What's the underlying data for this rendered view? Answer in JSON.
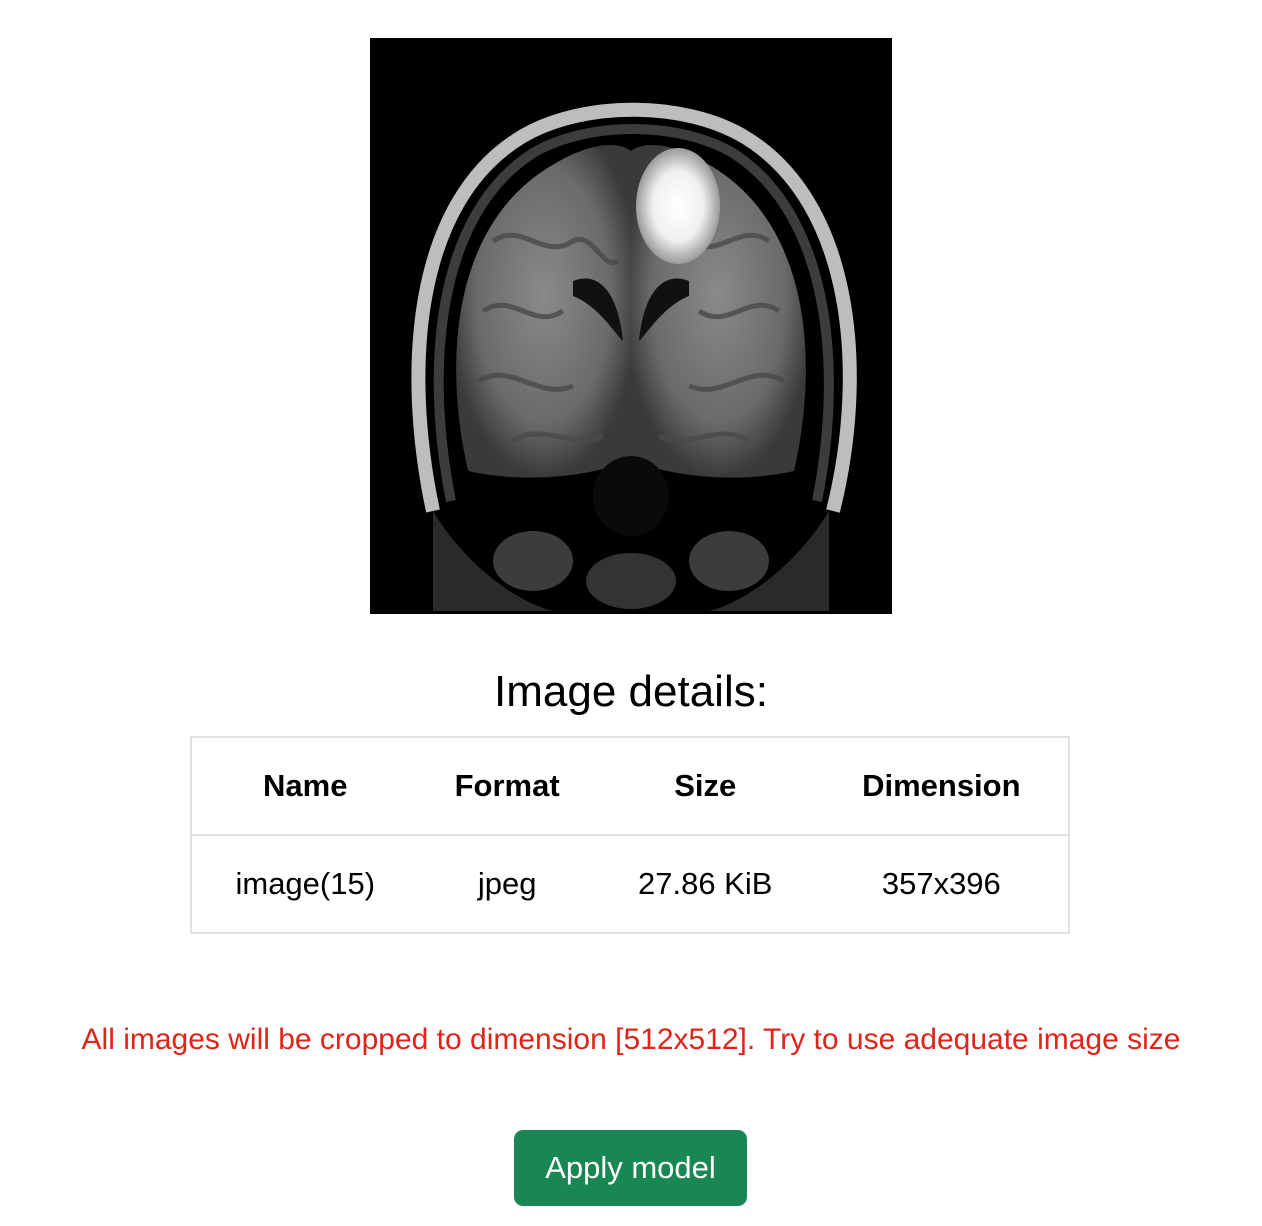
{
  "image_preview": {
    "alt": "brain MRI scan preview"
  },
  "details": {
    "title": "Image details:",
    "columns": [
      "Name",
      "Format",
      "Size",
      "Dimension"
    ],
    "row": {
      "name": "image(15)",
      "format": "jpeg",
      "size": "27.86 KiB",
      "dimension": "357x396"
    }
  },
  "warning": {
    "text": "All images will be cropped to dimension [512x512]. Try to use adequate image size",
    "color": "#e0241a"
  },
  "actions": {
    "apply_label": "Apply model",
    "apply_color": "#198754"
  }
}
